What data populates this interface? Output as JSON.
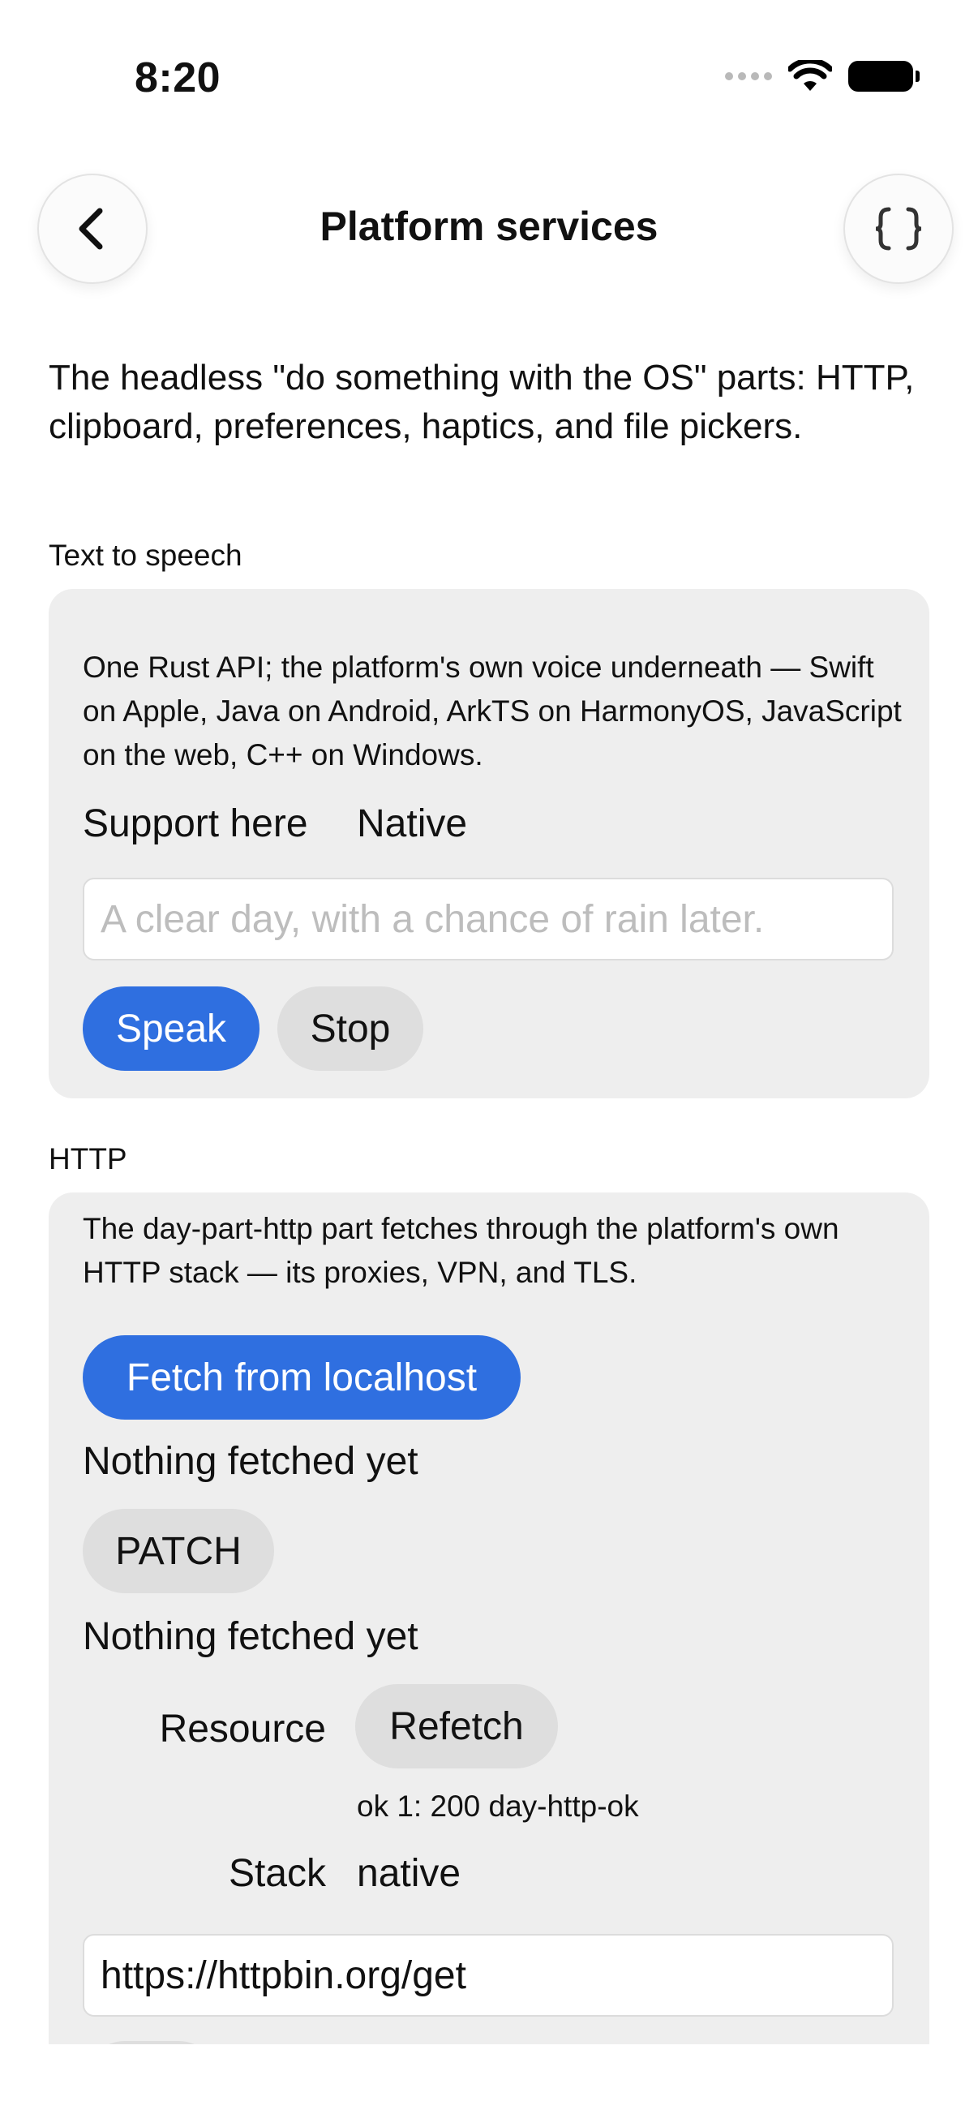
{
  "status": {
    "time": "8:20"
  },
  "nav": {
    "title": "Platform services",
    "back_icon": "chevron-left-icon",
    "json_icon": "braces-icon"
  },
  "intro": "The headless \"do something with the OS\" parts: HTTP, clipboard, preferences, haptics, and file pickers.",
  "tts": {
    "section_label": "Text to speech",
    "description": "One Rust API; the platform's own voice underneath — Swift on Apple, Java on Android, ArkTS on HarmonyOS, JavaScript on the web, C++ on Windows.",
    "support_label": "Support here",
    "support_value": "Native",
    "input_placeholder": "A clear day, with a chance of rain later.",
    "input_value": "",
    "speak_label": "Speak",
    "stop_label": "Stop"
  },
  "http": {
    "section_label": "HTTP",
    "description": "The day-part-http part fetches through the platform's own HTTP stack — its proxies, VPN, and TLS.",
    "fetch_label": "Fetch from localhost",
    "fetch_status": "Nothing fetched yet",
    "patch_label": "PATCH",
    "patch_status": "Nothing fetched yet",
    "resource_label": "Resource",
    "refetch_label": "Refetch",
    "resource_status": "ok 1: 200 day-http-ok",
    "stack_label": "Stack",
    "stack_value": "native",
    "url_value": "https://httpbin.org/get"
  },
  "colors": {
    "accent": "#2f6fe0",
    "card": "#eeeeee",
    "secondary_button": "#dedede"
  }
}
